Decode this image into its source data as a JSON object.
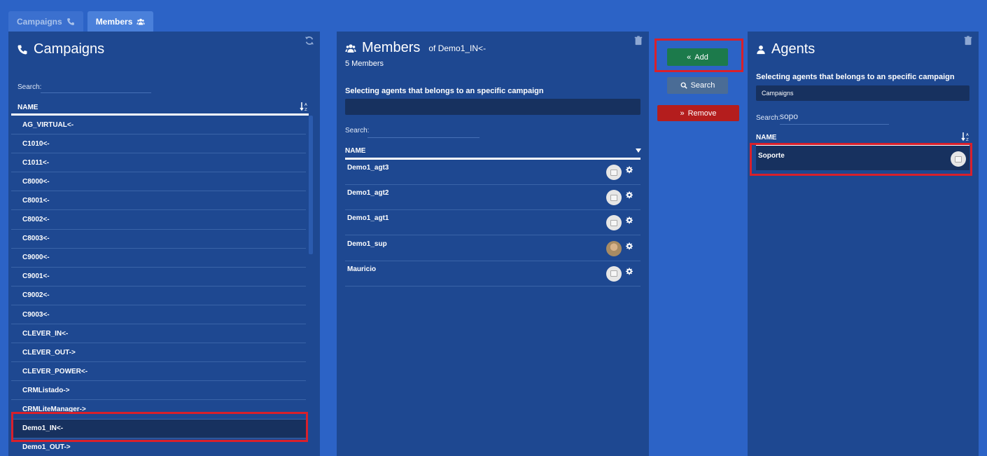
{
  "tabs": [
    {
      "label": "Campaigns"
    },
    {
      "label": "Members"
    }
  ],
  "campaigns": {
    "title": "Campaigns",
    "search_label": "Search:",
    "col_name": "NAME",
    "rows": [
      "AG_VIRTUAL<-",
      "C1010<-",
      "C1011<-",
      "C8000<-",
      "C8001<-",
      "C8002<-",
      "C8003<-",
      "C9000<-",
      "C9001<-",
      "C9002<-",
      "C9003<-",
      "CLEVER_IN<-",
      "CLEVER_OUT->",
      "CLEVER_POWER<-",
      "CRMListado->",
      "CRMLiteManager->",
      "Demo1_IN<-",
      "Demo1_OUT->"
    ],
    "selected_index": 16
  },
  "members": {
    "title": "Members",
    "of_label": "of Demo1_IN<-",
    "count": "5 Members",
    "desc": "Selecting agents that belongs to an specific campaign",
    "search_label": "Search:",
    "col_name": "NAME",
    "rows": [
      "Demo1_agt3",
      "Demo1_agt2",
      "Demo1_agt1",
      "Demo1_sup",
      "Mauricio"
    ]
  },
  "actions": {
    "add": "Add",
    "search": "Search",
    "remove": "Remove"
  },
  "agents": {
    "title": "Agents",
    "desc": "Selecting agents that belongs to an specific campaign",
    "filter_value": "Campaigns",
    "search_label": "Search:",
    "search_value": "sopo",
    "col_name": "NAME",
    "rows": [
      "Soporte"
    ]
  },
  "colors": {
    "background": "#2c63c6",
    "panel": "#1e4891",
    "selected_row": "#17315f",
    "add_green": "#1c7a4b",
    "remove_red": "#b41d1d",
    "highlight_red": "#d9202b"
  }
}
